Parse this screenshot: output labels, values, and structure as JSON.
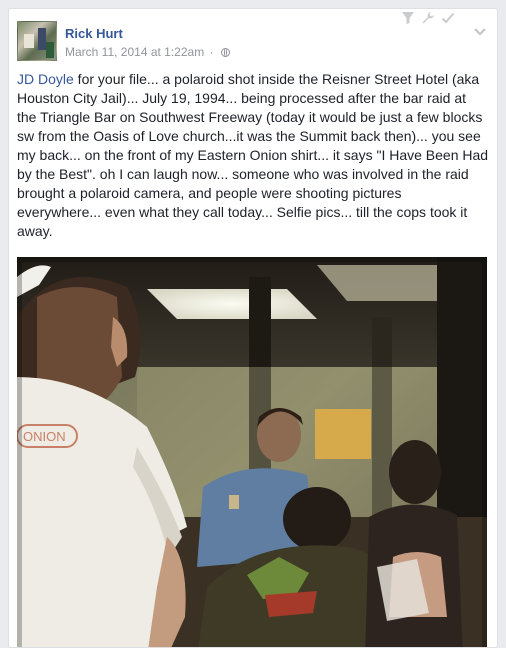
{
  "post": {
    "author": "Rick Hurt",
    "timestamp": "March 11, 2014 at 1:22am",
    "separator": "·",
    "privacy_icon": "globe-icon",
    "mention": "JD Doyle",
    "body": " for your file... a polaroid shot inside the Reisner Street Hotel (aka Houston City Jail)... July 19, 1994... being processed after the bar raid at the Triangle Bar on Southwest Freeway (today it would be just a few blocks sw from the Oasis of Love church...it was the Summit back then)... you see my back... on the front of my Eastern Onion shirt... it says \"I Have Been Had by the Best\". oh I can laugh now... someone who was involved in the raid brought a polaroid camera, and people were shooting pictures everywhere... even what they call today... Selfie pics... till the cops took it away.",
    "shirt_text": "ONION"
  },
  "toolbar": {
    "icons": [
      "filter-icon",
      "wrench-icon",
      "checkmark-icon"
    ],
    "menu_icon": "chevron-down-icon"
  },
  "colors": {
    "link": "#365899",
    "text": "#1d2129",
    "meta": "#90949c",
    "background": "#e9ebee"
  }
}
